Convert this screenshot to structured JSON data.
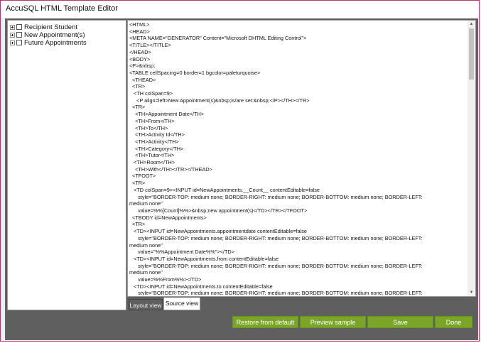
{
  "window": {
    "title": "AccuSQL HTML Template Editor"
  },
  "tree": {
    "items": [
      {
        "label": "Recipient Student"
      },
      {
        "label": "New Appointment(s)"
      },
      {
        "label": "Future Appointments"
      }
    ]
  },
  "editor": {
    "lines": [
      "<HTML>",
      "<HEAD>",
      "<META NAME=\"GENERATOR\" Content=\"Microsoft DHTML Editing Control\">",
      "<TITLE></TITLE>",
      "</HEAD>",
      "<BODY>",
      "<P>&nbsp;",
      "<TABLE cellSpacing=0 border=1 bgcolor=paleturquoise>",
      "  <THEAD>",
      "  <TR>",
      "   <TH colSpan=9>",
      "     <P align=left>New Appointment(s)&nbsp;is/are set:&nbsp;</P></TH></TR>",
      "  <TR>",
      "    <TH>Appointment Date</TH>",
      "    <TH>From</TH>",
      "    <TH>To</TH>",
      "    <TH>Activity Id</TH>",
      "    <TH>Activity</TH>",
      "    <TH>Category</TH>",
      "    <TH>Tutor</TH>",
      "   <TH>Room</TH>",
      "    <TH>With</TH></TR></THEAD>",
      "  <TFOOT>",
      "  <TR>",
      "   <TD colSpan=9><INPUT id=NewAppointments.__Count__ contentEditable=false",
      "      style=\"BORDER-TOP: medium none; BORDER-RIGHT: medium none; BORDER-BOTTOM: medium none; BORDER-LEFT:",
      "medium none\"",
      "      value=%%[Count]%%>&nbsp;new appointment(s)</TD></TR></TFOOT>",
      "  <TBODY id=NewAppointments>",
      "  <TR>",
      "   <TD><INPUT id=NewAppointments.appointmentdate contentEditable=false",
      "      style=\"BORDER-TOP: medium none; BORDER-RIGHT: medium none; BORDER-BOTTOM: medium none; BORDER-LEFT:",
      "medium none\"",
      "      value=\"%%Appointment Date%%\"></TD>",
      "   <TD><INPUT id=NewAppointments.from contentEditable=false",
      "      style=\"BORDER-TOP: medium none; BORDER-RIGHT: medium none; BORDER-BOTTOM: medium none; BORDER-LEFT:",
      "medium none\"",
      "      value=%%From%%></TD>",
      "   <TD><INPUT id=NewAppointments.to contentEditable=false",
      "      style=\"BORDER-TOP: medium none; BORDER-RIGHT: medium none; BORDER-BOTTOM: medium none; BORDER-LEFT:"
    ]
  },
  "tabs": {
    "layout": "Layout view",
    "source": "Source view"
  },
  "buttons": {
    "restore": "Restore from default",
    "preview": "Preview sample",
    "save": "Save",
    "done": "Done"
  },
  "colors": {
    "accent_button": "#7aa528",
    "window_border": "#c0306a",
    "panel_bg": "#5f5f5f"
  },
  "icons": {
    "scroll_up": "chevron-up-icon",
    "scroll_down": "chevron-down-icon"
  }
}
